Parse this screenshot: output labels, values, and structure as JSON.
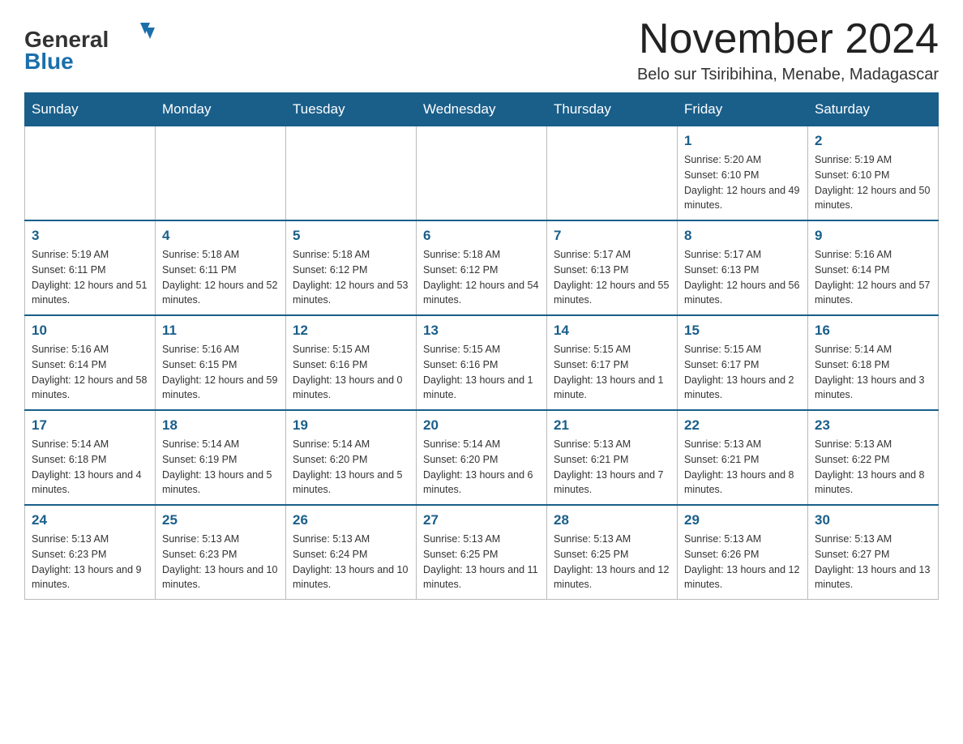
{
  "logo": {
    "general": "General",
    "blue": "Blue"
  },
  "title": "November 2024",
  "subtitle": "Belo sur Tsiribihina, Menabe, Madagascar",
  "days_of_week": [
    "Sunday",
    "Monday",
    "Tuesday",
    "Wednesday",
    "Thursday",
    "Friday",
    "Saturday"
  ],
  "weeks": [
    [
      {
        "day": "",
        "info": ""
      },
      {
        "day": "",
        "info": ""
      },
      {
        "day": "",
        "info": ""
      },
      {
        "day": "",
        "info": ""
      },
      {
        "day": "",
        "info": ""
      },
      {
        "day": "1",
        "info": "Sunrise: 5:20 AM\nSunset: 6:10 PM\nDaylight: 12 hours and 49 minutes."
      },
      {
        "day": "2",
        "info": "Sunrise: 5:19 AM\nSunset: 6:10 PM\nDaylight: 12 hours and 50 minutes."
      }
    ],
    [
      {
        "day": "3",
        "info": "Sunrise: 5:19 AM\nSunset: 6:11 PM\nDaylight: 12 hours and 51 minutes."
      },
      {
        "day": "4",
        "info": "Sunrise: 5:18 AM\nSunset: 6:11 PM\nDaylight: 12 hours and 52 minutes."
      },
      {
        "day": "5",
        "info": "Sunrise: 5:18 AM\nSunset: 6:12 PM\nDaylight: 12 hours and 53 minutes."
      },
      {
        "day": "6",
        "info": "Sunrise: 5:18 AM\nSunset: 6:12 PM\nDaylight: 12 hours and 54 minutes."
      },
      {
        "day": "7",
        "info": "Sunrise: 5:17 AM\nSunset: 6:13 PM\nDaylight: 12 hours and 55 minutes."
      },
      {
        "day": "8",
        "info": "Sunrise: 5:17 AM\nSunset: 6:13 PM\nDaylight: 12 hours and 56 minutes."
      },
      {
        "day": "9",
        "info": "Sunrise: 5:16 AM\nSunset: 6:14 PM\nDaylight: 12 hours and 57 minutes."
      }
    ],
    [
      {
        "day": "10",
        "info": "Sunrise: 5:16 AM\nSunset: 6:14 PM\nDaylight: 12 hours and 58 minutes."
      },
      {
        "day": "11",
        "info": "Sunrise: 5:16 AM\nSunset: 6:15 PM\nDaylight: 12 hours and 59 minutes."
      },
      {
        "day": "12",
        "info": "Sunrise: 5:15 AM\nSunset: 6:16 PM\nDaylight: 13 hours and 0 minutes."
      },
      {
        "day": "13",
        "info": "Sunrise: 5:15 AM\nSunset: 6:16 PM\nDaylight: 13 hours and 1 minute."
      },
      {
        "day": "14",
        "info": "Sunrise: 5:15 AM\nSunset: 6:17 PM\nDaylight: 13 hours and 1 minute."
      },
      {
        "day": "15",
        "info": "Sunrise: 5:15 AM\nSunset: 6:17 PM\nDaylight: 13 hours and 2 minutes."
      },
      {
        "day": "16",
        "info": "Sunrise: 5:14 AM\nSunset: 6:18 PM\nDaylight: 13 hours and 3 minutes."
      }
    ],
    [
      {
        "day": "17",
        "info": "Sunrise: 5:14 AM\nSunset: 6:18 PM\nDaylight: 13 hours and 4 minutes."
      },
      {
        "day": "18",
        "info": "Sunrise: 5:14 AM\nSunset: 6:19 PM\nDaylight: 13 hours and 5 minutes."
      },
      {
        "day": "19",
        "info": "Sunrise: 5:14 AM\nSunset: 6:20 PM\nDaylight: 13 hours and 5 minutes."
      },
      {
        "day": "20",
        "info": "Sunrise: 5:14 AM\nSunset: 6:20 PM\nDaylight: 13 hours and 6 minutes."
      },
      {
        "day": "21",
        "info": "Sunrise: 5:13 AM\nSunset: 6:21 PM\nDaylight: 13 hours and 7 minutes."
      },
      {
        "day": "22",
        "info": "Sunrise: 5:13 AM\nSunset: 6:21 PM\nDaylight: 13 hours and 8 minutes."
      },
      {
        "day": "23",
        "info": "Sunrise: 5:13 AM\nSunset: 6:22 PM\nDaylight: 13 hours and 8 minutes."
      }
    ],
    [
      {
        "day": "24",
        "info": "Sunrise: 5:13 AM\nSunset: 6:23 PM\nDaylight: 13 hours and 9 minutes."
      },
      {
        "day": "25",
        "info": "Sunrise: 5:13 AM\nSunset: 6:23 PM\nDaylight: 13 hours and 10 minutes."
      },
      {
        "day": "26",
        "info": "Sunrise: 5:13 AM\nSunset: 6:24 PM\nDaylight: 13 hours and 10 minutes."
      },
      {
        "day": "27",
        "info": "Sunrise: 5:13 AM\nSunset: 6:25 PM\nDaylight: 13 hours and 11 minutes."
      },
      {
        "day": "28",
        "info": "Sunrise: 5:13 AM\nSunset: 6:25 PM\nDaylight: 13 hours and 12 minutes."
      },
      {
        "day": "29",
        "info": "Sunrise: 5:13 AM\nSunset: 6:26 PM\nDaylight: 13 hours and 12 minutes."
      },
      {
        "day": "30",
        "info": "Sunrise: 5:13 AM\nSunset: 6:27 PM\nDaylight: 13 hours and 13 minutes."
      }
    ]
  ]
}
